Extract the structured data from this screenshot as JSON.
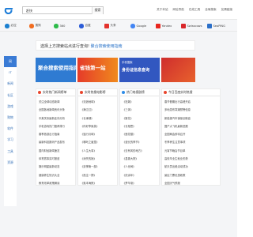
{
  "search": {
    "query": "赶快",
    "button": "搜索"
  },
  "top_links": [
    "关于本站",
    "网址导航",
    "在线工具",
    "全局搜索",
    "友情链接"
  ],
  "sites": [
    {
      "name": "必应",
      "color": "#1a7fd0"
    },
    {
      "name": "搜狗",
      "color": "#f16c1f"
    },
    {
      "name": "360",
      "color": "#2dbb4a"
    },
    {
      "name": "百度",
      "color": "#2b5bd7"
    },
    {
      "name": "头条",
      "color": "#e3322d"
    },
    {
      "name": "Google",
      "color": "#4285f4"
    },
    {
      "name": "Yandex",
      "color": "#e8261e"
    },
    {
      "name": "Swisscows",
      "color": "#d9262a"
    },
    {
      "name": "SeoPING",
      "color": "#2b6fc9"
    }
  ],
  "nav": [
    "网",
    "IT",
    "新闻",
    "社区",
    "游戏",
    "购物",
    "软件",
    "学习",
    "工具",
    "资源"
  ],
  "notice": {
    "text": "选择上方搜索站点进行查询!",
    "link": "聚合搜索使用指南"
  },
  "ads": [
    {
      "small": "",
      "big": "聚合搜索使用指南",
      "color": "#2f7bd2"
    },
    {
      "small": "",
      "big": "省钱第一站",
      "color": "#e53b2a"
    },
    {
      "small": "手机搜索",
      "big": "身份证信息查询",
      "color": "#3257c0"
    },
    {
      "small": "",
      "big": "",
      "color": "#cf2d2d"
    }
  ],
  "panels": [
    {
      "title": "实时热门新闻榜单",
      "icon_color": "#e8452d",
      "items": [
        "关注全球动态新闻",
        "全国各地新闻资讯头条",
        "中美关系最新走向分析",
        "手机游戏热门推荐排行",
        "春季旅游出行指南",
        "最新科技数码产品发布",
        "国内财经新闻速览",
        "体育赛事实时报道",
        "娱乐明星最新动态",
        "健康养生知识大全",
        "教育改革政策解读"
      ]
    },
    {
      "title": "实时热搜电影榜",
      "icon_color": "#e8452d",
      "items": [
        "《流浪地球》",
        "《满江红》",
        "《长津湖》",
        "《你好李焕英》",
        "《独行月球》",
        "《哪吒之魔童》",
        "《人生大事》",
        "《消失的她》",
        "《封神第一部》",
        "《孤注一掷》",
        "《奥本海默》"
      ]
    },
    {
      "title": "热门电视剧榜",
      "icon_color": "#2d8ce8",
      "items": [
        "《狂飙》",
        "《三体》",
        "《繁花》",
        "《长相思》",
        "《莲花楼》",
        "《漫长的季节》",
        "《去有风的地方》",
        "《县委大院》",
        "《人世间》",
        "《庆余年》",
        "《梦华录》"
      ]
    },
    {
      "title": "今日百度实时热搜",
      "icon_color": "#e8452d",
      "items": [
        "春节假期出行高峰开启",
        "多地发布寒潮预警信息",
        "新能源汽车销量创新高",
        "国产大飞机最新进展",
        "全国两会即将召开",
        "冬季养生注意事项",
        "元宵节晚会节目单",
        "高校毕业生就业形势",
        "航天员出舱活动成功",
        "景区门票优惠政策",
        "全国天气预报"
      ]
    }
  ]
}
